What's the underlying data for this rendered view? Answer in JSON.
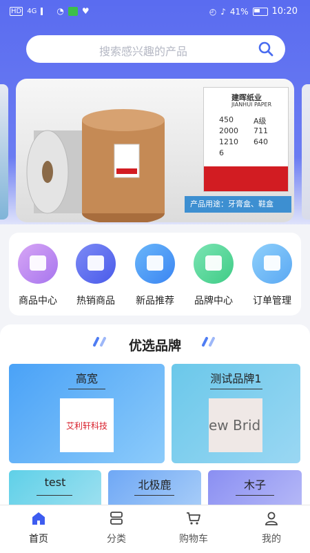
{
  "status": {
    "signal": "HD",
    "network": "4G",
    "battery": "41%",
    "time": "10:20"
  },
  "search": {
    "placeholder": "搜索感兴趣的产品"
  },
  "banner": {
    "caption": "产品用途：牙膏盒、鞋盒",
    "label_title": "建晖纸业",
    "label_subtitle": "JIANHUI PAPER",
    "label_values": [
      "450",
      "A级",
      "2000",
      "711",
      "1210",
      "640",
      "6"
    ]
  },
  "categories": [
    {
      "label": "商品中心",
      "color": "#c58cf0"
    },
    {
      "label": "热销商品",
      "color": "#5c6df0"
    },
    {
      "label": "新品推荐",
      "color": "#4d9cf5"
    },
    {
      "label": "品牌中心",
      "color": "#52d79a"
    },
    {
      "label": "订单管理",
      "color": "#6fb5f5"
    }
  ],
  "brands": {
    "title": "优选品牌",
    "items": [
      {
        "name": "高宽",
        "logo_text": "艾利轩科技"
      },
      {
        "name": "测试品牌1",
        "logo_text": "ew Brid"
      },
      {
        "name": "test"
      },
      {
        "name": "北极鹿"
      },
      {
        "name": "木子"
      }
    ]
  },
  "tabs": [
    {
      "label": "首页",
      "active": true
    },
    {
      "label": "分类"
    },
    {
      "label": "购物车"
    },
    {
      "label": "我的"
    }
  ]
}
